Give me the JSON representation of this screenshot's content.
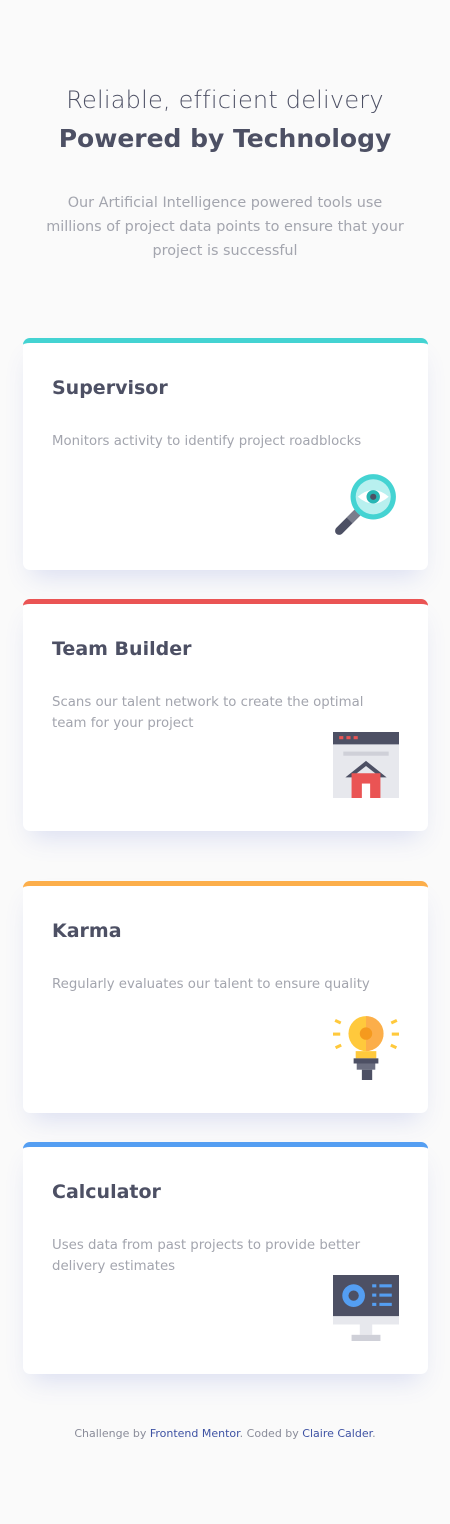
{
  "header": {
    "line1": "Reliable, efficient delivery",
    "line2": "Powered by Technology",
    "intro": "Our Artificial Intelligence powered tools use millions of project data points to ensure that your project is successful"
  },
  "cards": [
    {
      "title": "Supervisor",
      "text": "Monitors activity to identify project roadblocks",
      "icon": "supervisor-magnifier-icon",
      "accent": "#44d3d2"
    },
    {
      "title": "Team Builder",
      "text": "Scans our talent network to create the optimal team for your project",
      "icon": "team-builder-window-icon",
      "accent": "#ea5454"
    },
    {
      "title": "Karma",
      "text": "Regularly evaluates our talent to ensure quality",
      "icon": "karma-lightbulb-icon",
      "accent": "#fcae4a"
    },
    {
      "title": "Calculator",
      "text": "Uses data from past projects to provide better delivery estimates",
      "icon": "calculator-monitor-icon",
      "accent": "#549ef2"
    }
  ],
  "footer": {
    "prefix": "Challenge by",
    "link1": "Frontend Mentor",
    "middle": ". Coded by",
    "link2": "Claire Calder",
    "suffix": "."
  }
}
